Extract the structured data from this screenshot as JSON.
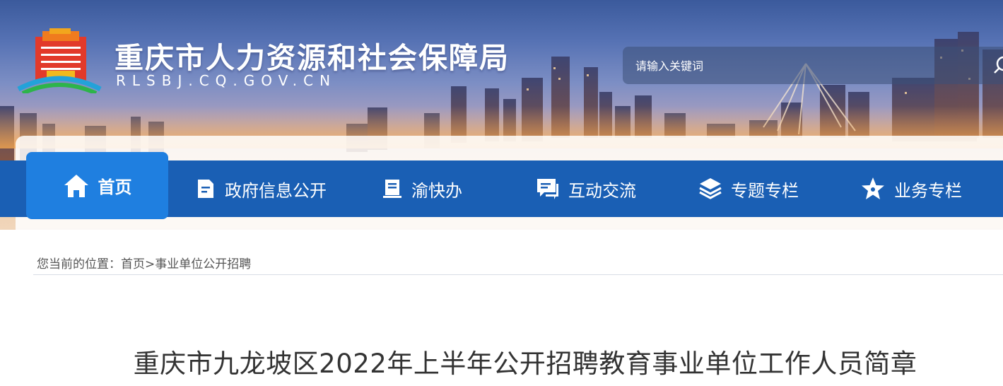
{
  "site": {
    "title": "重庆市人力资源和社会保障局",
    "domain": "RLSBJ.CQ.GOV.CN"
  },
  "search": {
    "placeholder": "请输入关键词",
    "icon": "search-icon"
  },
  "nav": {
    "items": [
      {
        "label": "首页",
        "icon": "home-icon",
        "active": true
      },
      {
        "label": "政府信息公开",
        "icon": "document-icon"
      },
      {
        "label": "渝快办",
        "icon": "book-icon"
      },
      {
        "label": "互动交流",
        "icon": "chat-icon"
      },
      {
        "label": "专题专栏",
        "icon": "layers-icon"
      },
      {
        "label": "业务专栏",
        "icon": "star-icon"
      }
    ]
  },
  "breadcrumb": {
    "prefix": "您当前的位置：",
    "home": "首页",
    "separator": ">",
    "current": "事业单位公开招聘"
  },
  "article": {
    "title": "重庆市九龙坡区2022年上半年公开招聘教育事业单位工作人员简章"
  },
  "colors": {
    "nav_bg": "#1a5fb4",
    "nav_active": "#1f7fe0",
    "title_text": "#333333"
  }
}
